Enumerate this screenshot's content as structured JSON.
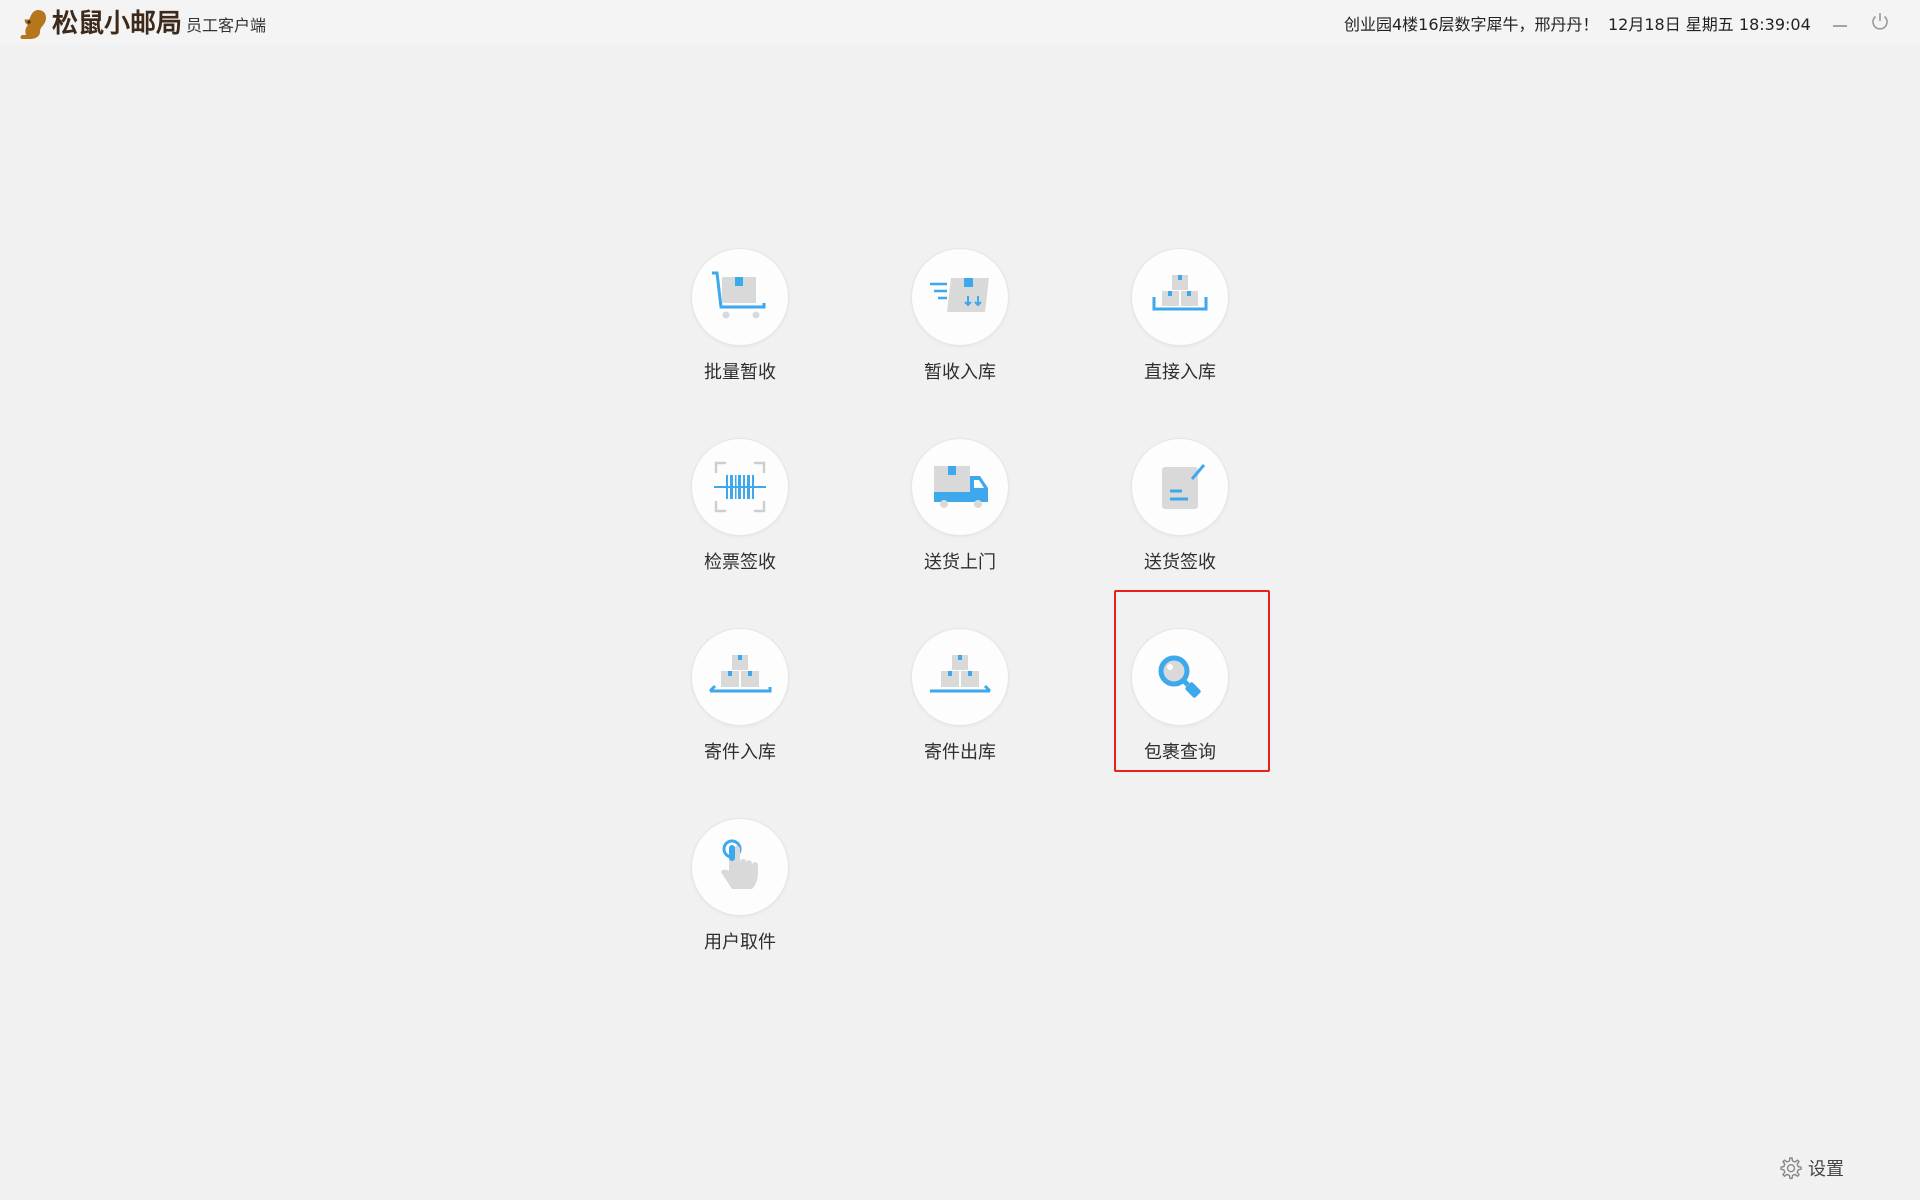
{
  "header": {
    "app_name": "松鼠小邮局",
    "app_subtitle": "员工客户端",
    "location_greeting": "创业园4楼16层数字犀牛，邢丹丹！",
    "datetime": "12月18日 星期五 18:39:04"
  },
  "menu": [
    {
      "label": "批量暂收",
      "icon": "cart-package-icon"
    },
    {
      "label": "暂收入库",
      "icon": "receive-storage-icon"
    },
    {
      "label": "直接入库",
      "icon": "direct-storage-icon"
    },
    {
      "label": "检票签收",
      "icon": "barcode-scan-icon"
    },
    {
      "label": "送货上门",
      "icon": "delivery-truck-icon"
    },
    {
      "label": "送货签收",
      "icon": "sign-document-icon"
    },
    {
      "label": "寄件入库",
      "icon": "send-storage-in-icon"
    },
    {
      "label": "寄件出库",
      "icon": "send-storage-out-icon"
    },
    {
      "label": "包裹查询",
      "icon": "magnifier-search-icon"
    },
    {
      "label": "用户取件",
      "icon": "hand-tap-icon"
    }
  ],
  "footer": {
    "settings_label": "设置",
    "settings_icon": "gear-icon"
  },
  "colors": {
    "accent_blue": "#3da8ec",
    "box_gray": "#d9d9d9",
    "highlight_red": "#e8211c",
    "logo_brown": "#b5761e"
  }
}
